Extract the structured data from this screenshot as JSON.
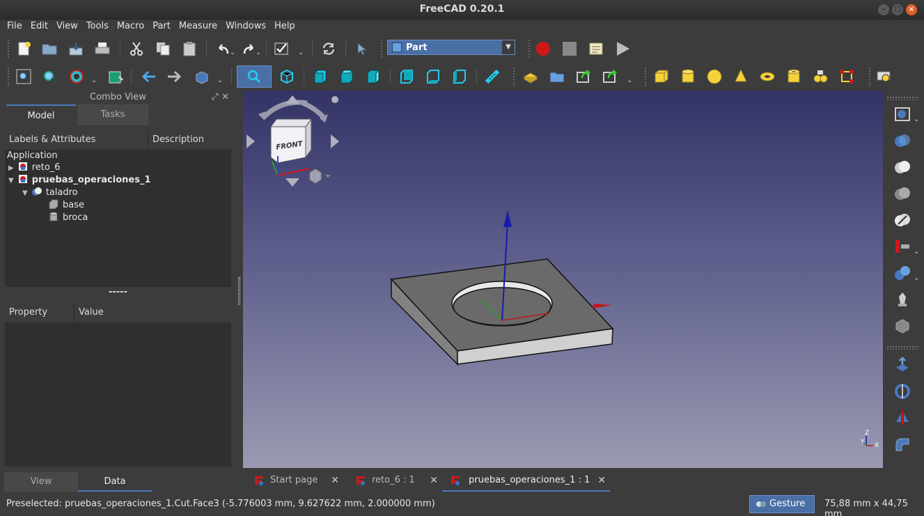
{
  "window": {
    "title": "FreeCAD 0.20.1"
  },
  "menu": [
    "File",
    "Edit",
    "View",
    "Tools",
    "Macro",
    "Part",
    "Measure",
    "Windows",
    "Help"
  ],
  "workbench": {
    "selected": "Part"
  },
  "combo_view": {
    "title": "Combo View",
    "tabs": [
      "Model",
      "Tasks"
    ],
    "tree_headers": [
      "Labels & Attributes",
      "Description"
    ],
    "application_label": "Application",
    "tree": [
      {
        "label": "reto_6",
        "bold": false
      },
      {
        "label": "pruebas_operaciones_1",
        "bold": true
      },
      {
        "label": "taladro",
        "bold": false
      },
      {
        "label": "base",
        "bold": false
      },
      {
        "label": "broca",
        "bold": false
      }
    ],
    "splitter": "-----",
    "prop_headers": [
      "Property",
      "Value"
    ],
    "bottom_tabs": [
      "View",
      "Data"
    ]
  },
  "navcube": {
    "face": "FRONT"
  },
  "axis_labels": {
    "z": "Z",
    "y": "Y",
    "x": "X"
  },
  "doc_tabs": [
    "Start page",
    "reto_6 : 1",
    "pruebas_operaciones_1 : 1"
  ],
  "status": {
    "preselected": "Preselected: pruebas_operaciones_1.Cut.Face3 (-5.776003 mm, 9.627622 mm, 2.000000 mm)",
    "nav_style": "Gesture",
    "dimensions": "75,88 mm x 44,75 mm"
  },
  "icons": {
    "toolbar1": [
      "new-document-icon",
      "open-icon",
      "save-icon",
      "print-icon",
      "cut-icon",
      "copy-icon",
      "paste-icon",
      "undo-icon",
      "redo-icon",
      "refresh-icon",
      "whats-this-icon",
      "record-macro-icon",
      "stop-macro-icon",
      "macros-icon",
      "execute-macro-icon"
    ],
    "toolbar2": [
      "fit-all-icon",
      "fit-selection-icon",
      "draw-style-icon",
      "bounding-box-icon",
      "back-icon",
      "forward-icon",
      "std-view-icon",
      "isometric-icon",
      "front-icon",
      "top-icon",
      "right-icon",
      "rear-icon",
      "bottom-icon",
      "left-icon",
      "measure-icon",
      "part-icon",
      "group-icon",
      "link-icon",
      "link-actions-icon",
      "box-icon",
      "cylinder-icon",
      "sphere-icon",
      "cone-icon",
      "torus-icon",
      "tube-icon",
      "shape-builder-icon",
      "primitives-icon",
      "measure-tools-icon"
    ],
    "right": [
      "boolean-icon",
      "cut-icon",
      "fuse-icon",
      "common-icon",
      "section-icon",
      "compound-icon",
      "check-geometry-icon",
      "defeaturing-icon",
      "extrude-icon",
      "revolve-icon",
      "mirror-icon",
      "fillet-icon"
    ]
  },
  "colors": {
    "accent": "#4a78c0",
    "viewport_top": "#333366",
    "viewport_bottom": "#9a9ab2"
  }
}
